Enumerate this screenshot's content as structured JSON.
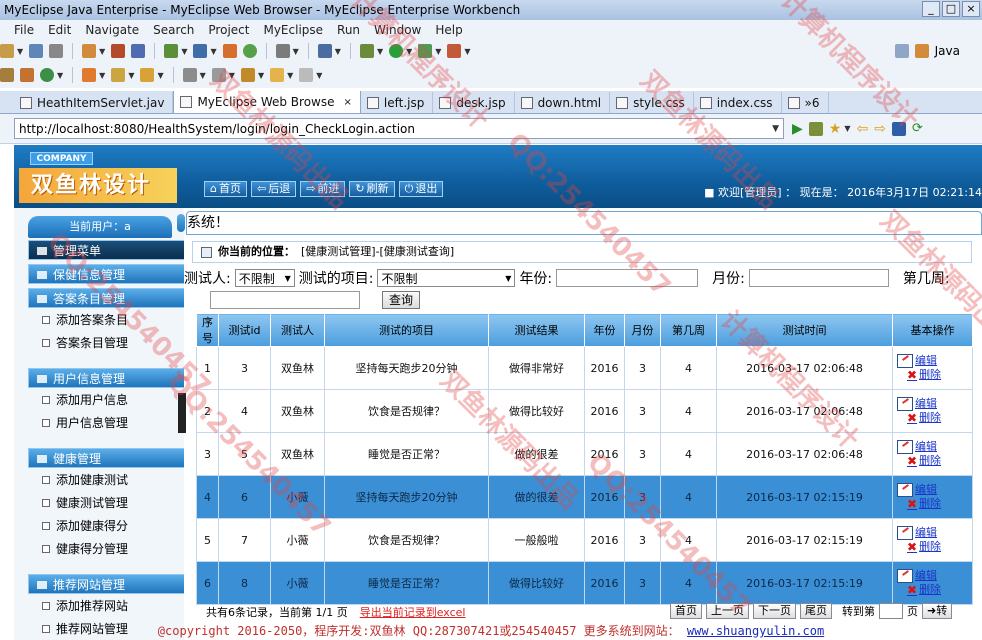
{
  "window": {
    "title": "MyEclipse Java Enterprise - MyEclipse Web Browser - MyEclipse Enterprise Workbench"
  },
  "menu": [
    "File",
    "Edit",
    "Navigate",
    "Search",
    "Project",
    "MyEclipse",
    "Run",
    "Window",
    "Help"
  ],
  "perspective": "Java",
  "tabs": [
    {
      "label": "HeathItemServlet.jav",
      "active": false
    },
    {
      "label": "MyEclipse Web Browse",
      "active": true
    },
    {
      "label": "left.jsp",
      "active": false
    },
    {
      "label": "desk.jsp",
      "active": false
    },
    {
      "label": "down.html",
      "active": false
    },
    {
      "label": "style.css",
      "active": false
    },
    {
      "label": "index.css",
      "active": false
    },
    {
      "label": "»6",
      "active": false
    }
  ],
  "address": "http://localhost:8080/HealthSystem/login/login_CheckLogin.action",
  "app": {
    "company": "COMPANY",
    "logo": "双鱼林设计",
    "nav": [
      "首页",
      "后退",
      "前进",
      "刷新",
      "退出"
    ],
    "welcome": "欢迎[管理员]",
    "now_label": "现在是：",
    "now": "2016年3月17日 02:21:14",
    "current_user": "当前用户：a",
    "system_title": "系统！",
    "location_label": "你当前的位置：",
    "location": "[健康测试管理]-[健康测试查询]"
  },
  "sidebar": {
    "menu_title": "管理菜单",
    "sections": [
      {
        "title": "保健信息管理",
        "items": []
      },
      {
        "title": "答案条目管理",
        "items": [
          "添加答案条目",
          "答案条目管理"
        ]
      },
      {
        "title": "用户信息管理",
        "items": [
          "添加用户信息",
          "用户信息管理"
        ]
      },
      {
        "title": "健康管理",
        "items": [
          "添加健康测试",
          "健康测试管理",
          "添加健康得分",
          "健康得分管理"
        ]
      },
      {
        "title": "推荐网站管理",
        "items": [
          "添加推荐网站",
          "推荐网站管理"
        ]
      }
    ]
  },
  "filters": {
    "tester_label": "测试人:",
    "tester_value": "不限制",
    "item_label": "测试的项目:",
    "item_value": "不限制",
    "year_label": "年份:",
    "month_label": "月份:",
    "week_label": "第几周:",
    "query_btn": "查询"
  },
  "table": {
    "headers": [
      "序号",
      "测试id",
      "测试人",
      "测试的项目",
      "测试结果",
      "年份",
      "月份",
      "第几周",
      "测试时间",
      "基本操作"
    ],
    "rows": [
      [
        "1",
        "3",
        "双鱼林",
        "坚持每天跑步20分钟",
        "做得非常好",
        "2016",
        "3",
        "4",
        "2016-03-17 02:06:48"
      ],
      [
        "2",
        "4",
        "双鱼林",
        "饮食是否规律？",
        "做得比较好",
        "2016",
        "3",
        "4",
        "2016-03-17 02:06:48"
      ],
      [
        "3",
        "5",
        "双鱼林",
        "睡觉是否正常？",
        "做的很差",
        "2016",
        "3",
        "4",
        "2016-03-17 02:06:48"
      ],
      [
        "4",
        "6",
        "小薇",
        "坚持每天跑步20分钟",
        "做的很差",
        "2016",
        "3",
        "4",
        "2016-03-17 02:15:19"
      ],
      [
        "5",
        "7",
        "小薇",
        "饮食是否规律？",
        "一般般啦",
        "2016",
        "3",
        "4",
        "2016-03-17 02:15:19"
      ],
      [
        "6",
        "8",
        "小薇",
        "睡觉是否正常？",
        "做得比较好",
        "2016",
        "3",
        "4",
        "2016-03-17 02:15:19"
      ]
    ],
    "highlight_rows": [
      3,
      5
    ],
    "edit_label": "编辑",
    "delete_label": "删除"
  },
  "pager": {
    "summary": "共有6条记录，当前第 1/1 页",
    "export": "导出当前记录到excel",
    "first": "首页",
    "prev": "上一页",
    "next": "下一页",
    "last": "尾页",
    "goto_label": "转到第",
    "page_label": "页",
    "go": "转"
  },
  "footer": {
    "text": "@copyright 2016-2050，程序开发:双鱼林  QQ:287307421或254540457  更多系统到网站：",
    "link": "www.shuangyulin.com"
  },
  "watermark": [
    "QQ:254540457",
    "双鱼林源码出品",
    "计算机程序设计"
  ],
  "colors": {
    "header_blue": "#0f5d9d",
    "highlight_row": "#3b8fd5",
    "footer_red": "#c0302c"
  }
}
